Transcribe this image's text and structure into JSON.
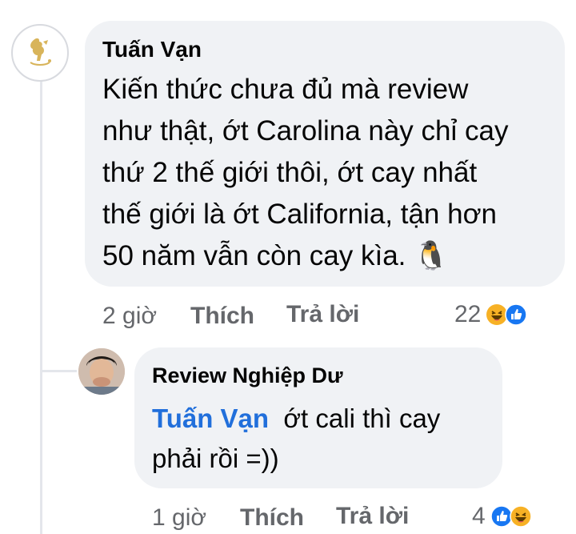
{
  "comment": {
    "author": "Tuấn Vạn",
    "lines": [
      "Kiến thức chưa đủ mà review",
      "như thật, ớt Carolina này chỉ cay",
      "thứ 2 thế giới thôi, ớt cay nhất",
      "thế giới là ớt California, tận hơn",
      "50 năm vẫn còn cay kìa."
    ],
    "emoji": "🐧",
    "time": "2 giờ",
    "like_label": "Thích",
    "reply_label": "Trả lời",
    "reaction_count": "22",
    "reactions": [
      "haha-icon",
      "like-icon"
    ]
  },
  "reply": {
    "author": "Review Nghiệp Dư",
    "mention": "Tuấn Vạn",
    "text_after_mention": "ớt cali thì cay",
    "line2": "phải rồi =))",
    "time": "1 giờ",
    "like_label": "Thích",
    "reply_label": "Trả lời",
    "reaction_count": "4",
    "reactions": [
      "like-icon",
      "haha-icon"
    ]
  },
  "colors": {
    "bubble": "#f0f2f5",
    "mention": "#216fdb",
    "meta": "#65676b",
    "like_blue": "#1877f2",
    "haha_yellow": "#f7b125"
  }
}
